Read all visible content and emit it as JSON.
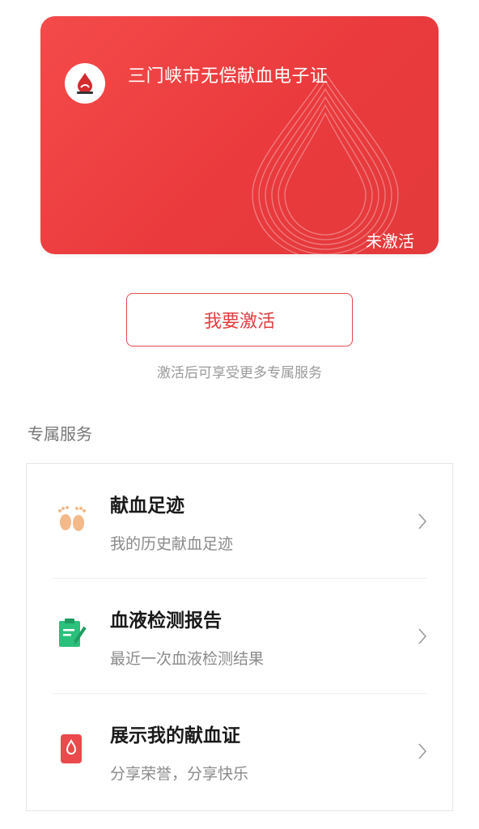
{
  "card": {
    "title": "三门峡市无偿献血电子证",
    "status": "未激活",
    "colors": {
      "bg": "#ea3a3d",
      "text": "#ffffff"
    }
  },
  "activate": {
    "button_label": "我要激活",
    "hint": "激活后可享受更多专属服务"
  },
  "services_section": {
    "title": "专属服务",
    "items": [
      {
        "name": "献血足迹",
        "desc": "我的历史献血足迹",
        "icon": "footprints-icon"
      },
      {
        "name": "血液检测报告",
        "desc": "最近一次血液检测结果",
        "icon": "report-icon"
      },
      {
        "name": "展示我的献血证",
        "desc": "分享荣誉，分享快乐",
        "icon": "blood-drop-icon"
      }
    ]
  },
  "accent": "#e23d40"
}
